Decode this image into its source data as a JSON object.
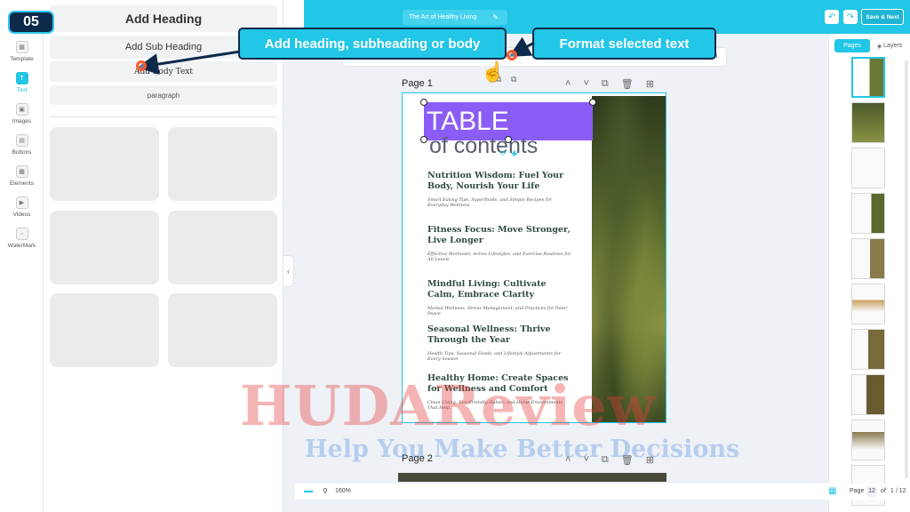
{
  "step_badge": "05",
  "header": {
    "doc_title": "The Art of Healthy Living",
    "save_label": "Save & Next"
  },
  "rail": {
    "items": [
      {
        "label": "Template",
        "icon": "template-icon"
      },
      {
        "label": "Text",
        "icon": "text-icon",
        "active": true
      },
      {
        "label": "Images",
        "icon": "image-icon"
      },
      {
        "label": "Buttons",
        "icon": "button-icon"
      },
      {
        "label": "Elements",
        "icon": "elements-icon"
      },
      {
        "label": "Videos",
        "icon": "video-icon"
      },
      {
        "label": "WaterMark",
        "icon": "watermark-icon"
      }
    ]
  },
  "text_panel": {
    "heading": "Add Heading",
    "subheading": "Add Sub Heading",
    "body": "Add Body Text",
    "paragraph": "paragraph"
  },
  "callouts": {
    "add_text": "Add heading, subheading or body",
    "format_text": "Format selected text"
  },
  "canvas": {
    "page1_label": "Page 1",
    "page2_label": "Page 2",
    "toc_title": "TABLE",
    "toc_subtitle": "of contents",
    "entries": [
      {
        "title": "Nutrition Wisdom: Fuel Your Body, Nourish Your Life",
        "subtitle": "Smart Eating Tips, Superfoods, and Simple Recipes for Everyday Wellness"
      },
      {
        "title": "Fitness Focus: Move Stronger, Live Longer",
        "subtitle": "Effective Workouts, Active Lifestyles, and Exercise Routines for All Levels"
      },
      {
        "title": "Mindful Living: Cultivate Calm, Embrace Clarity",
        "subtitle": "Mental Wellness, Stress Management, and Practices for Inner Peace"
      },
      {
        "title": "Seasonal Wellness: Thrive Through the Year",
        "subtitle": "Health Tips, Seasonal Foods, and Lifestyle Adjustments for Every Season"
      },
      {
        "title": "Healthy Home: Create Spaces for Wellness and Comfort",
        "subtitle": "Clean Living, Eco-Friendly Habits, and Home Environments That Heal"
      }
    ]
  },
  "right_panel": {
    "tab_pages": "Pages",
    "tab_layers": "Layers",
    "thumbnail_count": 10
  },
  "bottom_bar": {
    "zoom": "160%",
    "page_label": "Page",
    "current_page": "12",
    "of_label": "of",
    "total_pages": "1 / 12"
  },
  "watermark": {
    "title": "HUDAReview",
    "tagline": "Help You Make Better Decisions"
  },
  "colors": {
    "accent": "#22c6e6",
    "toc_highlight": "#8b5cf6",
    "annotation_marker": "#ff5a2a",
    "badge_bg": "#0d2a4a"
  }
}
